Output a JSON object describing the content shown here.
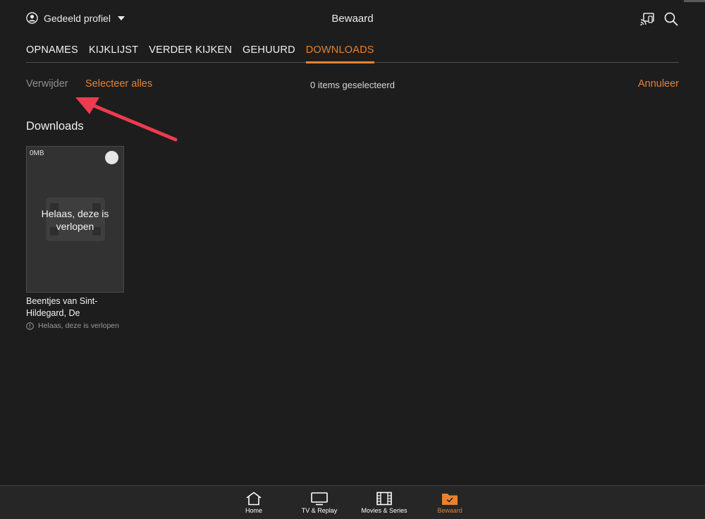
{
  "header": {
    "profile_label": "Gedeeld profiel",
    "title": "Bewaard",
    "icons": [
      "profile-icon",
      "caret-down-icon",
      "cast-icon",
      "search-icon"
    ]
  },
  "tabs": [
    {
      "label": "OPNAMES",
      "active": false
    },
    {
      "label": "KIJKLIJST",
      "active": false
    },
    {
      "label": "VERDER KIJKEN",
      "active": false
    },
    {
      "label": "GEHUURD",
      "active": false
    },
    {
      "label": "DOWNLOADS",
      "active": true
    }
  ],
  "actions": {
    "delete_label": "Verwijder",
    "select_all_label": "Selecteer alles",
    "selected_count": "0 items geselecteerd",
    "cancel_label": "Annuleer"
  },
  "section": {
    "title": "Downloads"
  },
  "downloads": [
    {
      "size": "0MB",
      "overlay_message": "Helaas, deze is verlopen",
      "title": "Beentjes van Sint-Hildegard, De",
      "status": "Helaas, deze is verlopen",
      "selected": false
    }
  ],
  "bottom_nav": [
    {
      "label": "Home",
      "icon": "home-icon",
      "active": false
    },
    {
      "label": "TV & Replay",
      "icon": "tv-icon",
      "active": false
    },
    {
      "label": "Movies & Series",
      "icon": "film-icon",
      "active": false
    },
    {
      "label": "Bewaard",
      "icon": "saved-folder-icon",
      "active": true
    }
  ],
  "colors": {
    "background": "#1d1d1d",
    "accent": "#e8822f",
    "annotation_arrow": "#ee3b4f"
  }
}
